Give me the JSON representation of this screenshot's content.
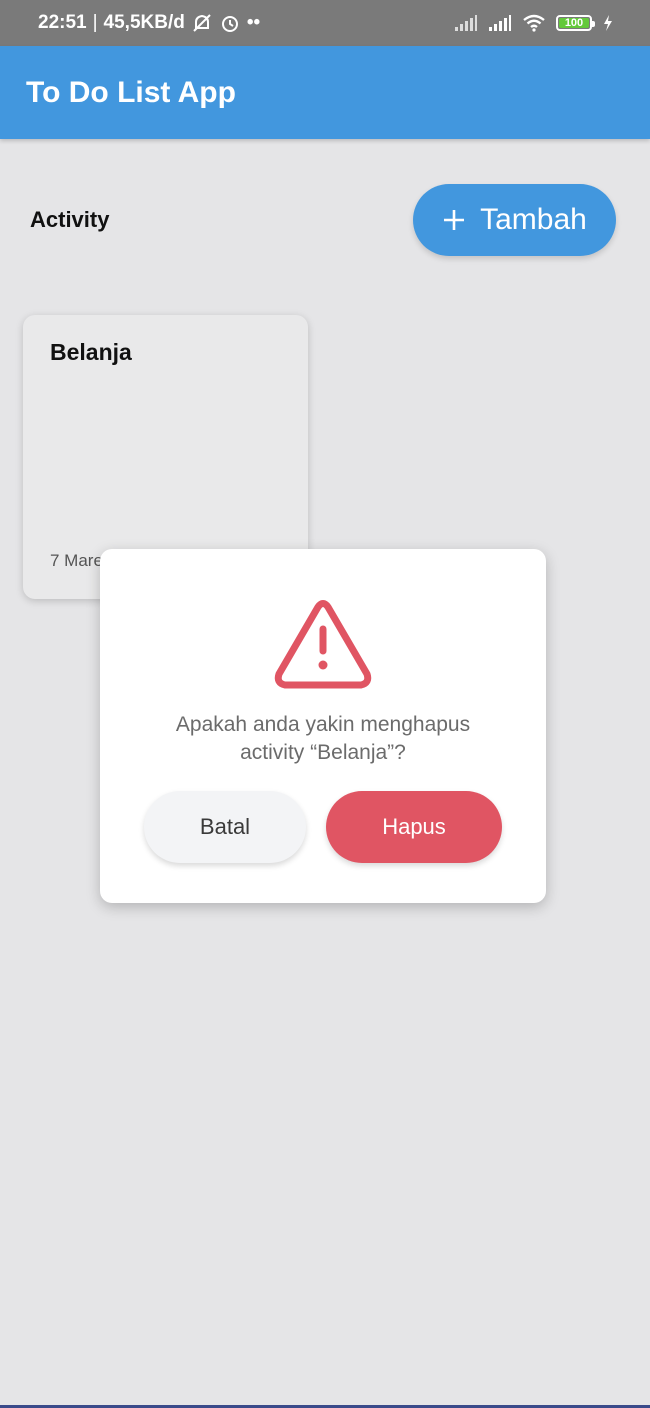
{
  "status_bar": {
    "time": "22:51",
    "separator": "|",
    "network_speed": "45,5KB/d",
    "extra": "••",
    "battery_level": "100",
    "icons": [
      "mute-notification-icon",
      "alarm-icon",
      "signal-icon",
      "signal-icon",
      "wifi-icon",
      "battery-icon",
      "charging-icon"
    ]
  },
  "app_bar": {
    "title": "To Do List App",
    "color": "#4297de"
  },
  "header": {
    "section_label": "Activity",
    "add_button_label": "Tambah",
    "add_button_icon": "plus-icon"
  },
  "activities": [
    {
      "title": "Belanja",
      "date": "7 Maret 2021"
    }
  ],
  "dialog": {
    "icon": "warning-icon",
    "message_line1": "Apakah anda yakin menghapus",
    "message_line2": "activity “Belanja”?",
    "cancel_label": "Batal",
    "delete_label": "Hapus",
    "delete_color": "#e05563"
  }
}
